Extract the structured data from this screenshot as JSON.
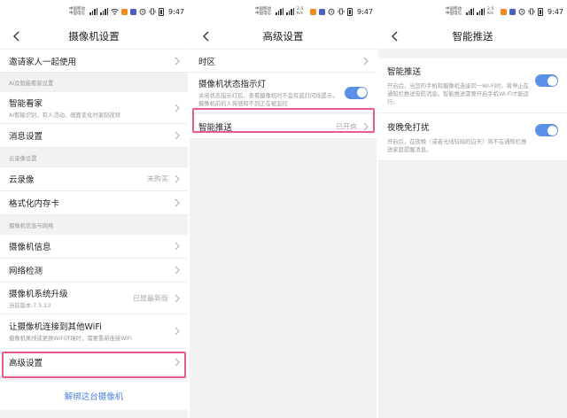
{
  "status_bar": {
    "carrier_1": "中国移动",
    "carrier_2": "中国电信",
    "time": "9:47",
    "speed": "2.5 K/s",
    "icons": [
      "signal-icon",
      "wifi-icon",
      "app-notification-icon",
      "alarm-icon",
      "vibrate-icon",
      "battery-icon"
    ]
  },
  "screen_camera_settings": {
    "title": "摄像机设置",
    "invite": "邀请家人一起使用",
    "section_ai": "AI及智能看家设置",
    "smart_guard": {
      "label": "智能看家",
      "sub": "AI智能识别，有人活动、画面变化时录制视频"
    },
    "message_settings": "消息设置",
    "section_cloud": "云录像设置",
    "cloud_recording": {
      "label": "云录像",
      "value": "未购买"
    },
    "format_sd": "格式化内存卡",
    "section_info": "摄像机信息与网络",
    "camera_info": "摄像机信息",
    "network_check": "网络检测",
    "firmware": {
      "label": "摄像机系统升级",
      "sub": "当前版本:7.5.13",
      "value": "已是最新版"
    },
    "connect_wifi": {
      "label": "让摄像机连接到其他WiFi",
      "sub": "摄像机离线或更换WiFi环境时，需要重新连接WiFi"
    },
    "advanced": "高级设置",
    "unbind": "解绑这台摄像机"
  },
  "screen_advanced": {
    "title": "高级设置",
    "timezone": "时区",
    "indicator": {
      "label": "摄像机状态指示灯",
      "sub": "关闭状态指示灯后，查看摄像机时不会有蓝灯闪烁提示，摄像机前的人将感知不到正在被监控"
    },
    "smart_push": {
      "label": "智能推送",
      "value": "已开启"
    }
  },
  "screen_smart_push": {
    "title": "智能推送",
    "push": {
      "label": "智能推送",
      "sub": "开启后，当您的手机和摄像机连接同一Wi-Fi时，将停止在通知栏推送安防消息。智能推送需要开启手机Wi-Fi才能运行。"
    },
    "night": {
      "label": "夜晚免打扰",
      "sub": "开启后，在夜晚（或者光线较暗的白天）将不在通知栏推送家庭提醒消息。"
    }
  },
  "colors": {
    "accent": "#5b8fe6",
    "highlight": "#e85a93",
    "link": "#4a7fd6"
  }
}
